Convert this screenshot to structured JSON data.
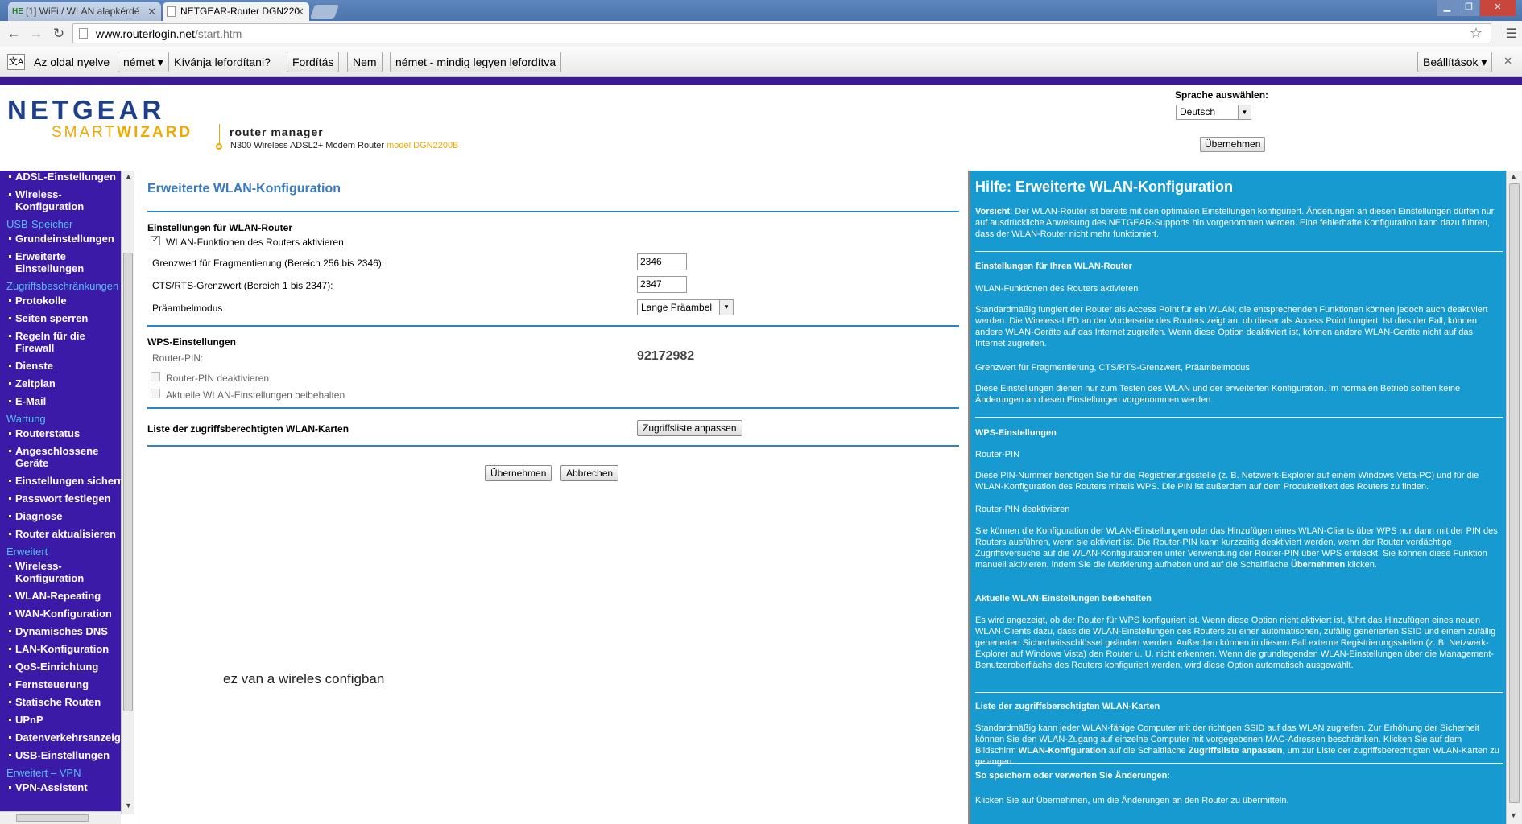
{
  "browser": {
    "tabs": [
      {
        "label": "[1] WiFi / WLAN alapkérdé",
        "favicon": "HE"
      },
      {
        "label": "NETGEAR-Router DGN220",
        "favicon": ""
      }
    ],
    "url_host": "www.routerlogin.net",
    "url_path": "/start.htm"
  },
  "translate_bar": {
    "page_language_label": "Az oldal nyelve",
    "language": "német",
    "question": "Kívánja lefordítani?",
    "translate_button": "Fordítás",
    "no_button": "Nem",
    "always_button": "német - mindig legyen lefordítva",
    "settings_button": "Beállítások"
  },
  "header": {
    "logo_main": "NETGEAR",
    "logo_smart": "SMART",
    "logo_wizard": "WIZARD",
    "router_manager": "router manager",
    "model_desc": "N300 Wireless ADSL2+ Modem Router",
    "model_name": "model DGN2200B",
    "lang_label": "Sprache auswählen:",
    "lang_value": "Deutsch",
    "lang_apply": "Übernehmen"
  },
  "menu": [
    {
      "type": "item",
      "label": "ADSL-Einstellungen"
    },
    {
      "type": "item",
      "label": "Wireless-\nKonfiguration"
    },
    {
      "type": "head",
      "label": "USB-Speicher"
    },
    {
      "type": "item",
      "label": "Grundeinstellungen"
    },
    {
      "type": "item",
      "label": "Erweiterte\nEinstellungen"
    },
    {
      "type": "head",
      "label": "Zugriffsbeschränkungen"
    },
    {
      "type": "item",
      "label": "Protokolle"
    },
    {
      "type": "item",
      "label": "Seiten sperren"
    },
    {
      "type": "item",
      "label": "Regeln für die\nFirewall"
    },
    {
      "type": "item",
      "label": "Dienste"
    },
    {
      "type": "item",
      "label": "Zeitplan"
    },
    {
      "type": "item",
      "label": "E-Mail"
    },
    {
      "type": "head",
      "label": "Wartung"
    },
    {
      "type": "item",
      "label": "Routerstatus"
    },
    {
      "type": "item",
      "label": "Angeschlossene\nGeräte"
    },
    {
      "type": "item",
      "label": "Einstellungen sichern"
    },
    {
      "type": "item",
      "label": "Passwort festlegen"
    },
    {
      "type": "item",
      "label": "Diagnose"
    },
    {
      "type": "item",
      "label": "Router aktualisieren"
    },
    {
      "type": "head",
      "label": "Erweitert"
    },
    {
      "type": "item",
      "label": "Wireless-\nKonfiguration"
    },
    {
      "type": "item",
      "label": "WLAN-Repeating"
    },
    {
      "type": "item",
      "label": "WAN-Konfiguration"
    },
    {
      "type": "item",
      "label": "Dynamisches DNS"
    },
    {
      "type": "item",
      "label": "LAN-Konfiguration"
    },
    {
      "type": "item",
      "label": "QoS-Einrichtung"
    },
    {
      "type": "item",
      "label": "Fernsteuerung"
    },
    {
      "type": "item",
      "label": "Statische Routen"
    },
    {
      "type": "item",
      "label": "UPnP"
    },
    {
      "type": "item",
      "label": "Datenverkehrsanzeige"
    },
    {
      "type": "item",
      "label": "USB-Einstellungen"
    },
    {
      "type": "head",
      "label": "Erweitert – VPN"
    },
    {
      "type": "item",
      "label": "VPN-Assistent"
    }
  ],
  "main": {
    "title": "Erweiterte WLAN-Konfiguration",
    "sec_router": "Einstellungen für WLAN-Router",
    "enable_wlan": "WLAN-Funktionen des Routers aktivieren",
    "frag_label": "Grenzwert für Fragmentierung (Bereich 256 bis 2346):",
    "frag_value": "2346",
    "cts_label": "CTS/RTS-Grenzwert (Bereich 1 bis 2347):",
    "cts_value": "2347",
    "preamble_label": "Präambelmodus",
    "preamble_value": "Lange Präambel",
    "sec_wps": "WPS-Einstellungen",
    "pin_label": "Router-PIN:",
    "pin_value": "92172982",
    "pin_disable": "Router-PIN deaktivieren",
    "keep_settings": "Aktuelle WLAN-Einstellungen beibehalten",
    "access_list_label": "Liste der zugriffsberechtigten WLAN-Karten",
    "access_list_button": "Zugriffsliste anpassen",
    "apply_button": "Übernehmen",
    "cancel_button": "Abbrechen",
    "annotation": "ez van a wireles configban"
  },
  "help": {
    "title": "Hilfe: Erweiterte WLAN-Konfiguration",
    "caution_bold": "Vorsicht",
    "caution": ": Der WLAN-Router ist bereits mit den optimalen Einstellungen konfiguriert. Änderungen an diesen Einstellungen dürfen nur auf ausdrückliche Anweisung des NETGEAR-Supports hin vorgenommen werden. Eine fehlerhafte Konfiguration kann dazu führen, dass der WLAN-Router nicht mehr funktioniert.",
    "sec1": "Einstellungen für Ihren WLAN-Router",
    "sec1_sub": "WLAN-Funktionen des Routers aktivieren",
    "sec1_text": "Standardmäßig fungiert der Router als Access Point für ein WLAN; die entsprechenden Funktionen können jedoch auch deaktiviert werden. Die Wireless-LED an der Vorderseite des Routers zeigt an, ob dieser als Access Point fungiert. Ist dies der Fall, können andere WLAN-Geräte auf das Internet zugreifen. Wenn diese Option deaktiviert ist, können andere WLAN-Geräte nicht auf das Internet zugreifen.",
    "sec1_sub2": "Grenzwert für Fragmentierung, CTS/RTS-Grenzwert, Präambelmodus",
    "sec1_text2": "Diese Einstellungen dienen nur zum Testen des WLAN und der erweiterten Konfiguration. Im normalen Betrieb sollten keine Änderungen an diesen Einstellungen vorgenommen werden.",
    "sec2": "WPS-Einstellungen",
    "sec2_sub": "Router-PIN",
    "sec2_text": "Diese PIN-Nummer benötigen Sie für die Registrierungsstelle (z. B. Netzwerk-Explorer auf einem Windows Vista-PC) und für die WLAN-Konfiguration des Routers mittels WPS. Die PIN ist außerdem auf dem Produktetikett des Routers zu finden.",
    "sec2_sub2": "Router-PIN deaktivieren",
    "sec2_text2": "Sie können die Konfiguration der WLAN-Einstellungen oder das Hinzufügen eines WLAN-Clients über WPS nur dann mit der PIN des Routers ausführen, wenn sie aktiviert ist. Die Router-PIN kann kurzzeitig deaktiviert werden, wenn der Router verdächtige Zugriffsversuche auf die WLAN-Konfigurationen unter Verwendung der Router-PIN über WPS entdeckt. Sie können diese Funktion manuell aktivieren, indem Sie die Markierung aufheben und auf die Schaltfläche",
    "sec2_text2_bold": "Übernehmen",
    "sec2_text2_end": "klicken.",
    "sec2_sub3": "Aktuelle WLAN-Einstellungen beibehalten",
    "sec2_text3": "Es wird angezeigt, ob der Router für WPS konfiguriert ist. Wenn diese Option nicht aktiviert ist, führt das Hinzufügen eines neuen WLAN-Clients dazu, dass die WLAN-Einstellungen des Routers zu einer automatischen, zufällig generierten SSID und einem zufällig generierten Sicherheitsschlüssel geändert werden. Außerdem können in diesem Fall externe Registrierungsstellen (z. B. Netzwerk-Explorer auf Windows Vista) den Router u. U. nicht erkennen. Wenn die grundlegenden WLAN-Einstellungen über die Management-Benutzeroberfläche des Routers konfiguriert werden, wird diese Option automatisch ausgewählt.",
    "sec3": "Liste der zugriffsberechtigten WLAN-Karten",
    "sec3_text_a": "Standardmäßig kann jeder WLAN-fähige Computer mit der richtigen SSID auf das WLAN zugreifen. Zur Erhöhung der Sicherheit können Sie den WLAN-Zugang auf einzelne Computer mit vorgegebenen MAC-Adressen beschränken. Klicken Sie auf dem Bildschirm",
    "sec3_bold1": "WLAN-Konfiguration",
    "sec3_text_b": "auf die Schaltfläche",
    "sec3_bold2": "Zugriffsliste anpassen",
    "sec3_text_c": ", um zur Liste der zugriffsberechtigten WLAN-Karten zu gelangen.",
    "sec4": "So speichern oder verwerfen Sie Änderungen:",
    "sec4_text": "Klicken Sie auf Übernehmen, um die Änderungen an den Router zu übermitteln."
  }
}
